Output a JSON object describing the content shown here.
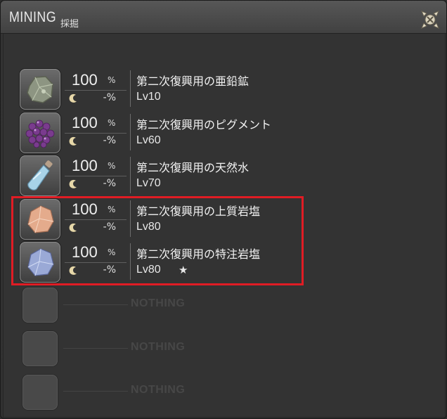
{
  "window": {
    "title": "MINING",
    "subtitle": "採掘",
    "close_icon": "close-cross-icon"
  },
  "items": [
    {
      "name": "第二次復興用の亜鉛鉱",
      "level": "Lv10",
      "gather_rate": "100",
      "percent_sign": "%",
      "hq_rate": "-%",
      "icon": "zinc-ore-icon",
      "starred": false
    },
    {
      "name": "第二次復興用のピグメント",
      "level": "Lv60",
      "gather_rate": "100",
      "percent_sign": "%",
      "hq_rate": "-%",
      "icon": "purple-pigment-icon",
      "starred": false
    },
    {
      "name": "第二次復興用の天然水",
      "level": "Lv70",
      "gather_rate": "100",
      "percent_sign": "%",
      "hq_rate": "-%",
      "icon": "water-bottle-icon",
      "starred": false
    },
    {
      "name": "第二次復興用の上質岩塩",
      "level": "Lv80",
      "gather_rate": "100",
      "percent_sign": "%",
      "hq_rate": "-%",
      "icon": "orange-rock-salt-icon",
      "starred": false
    },
    {
      "name": "第二次復興用の特注岩塩",
      "level": "Lv80",
      "gather_rate": "100",
      "percent_sign": "%",
      "hq_rate": "-%",
      "icon": "blue-rock-salt-icon",
      "starred": true,
      "star_glyph": "★"
    }
  ],
  "empty_slots": [
    {
      "label": "NOTHING"
    },
    {
      "label": "NOTHING"
    },
    {
      "label": "NOTHING"
    }
  ],
  "colors": {
    "highlight": "#e01c24",
    "window_bg": "#333333"
  }
}
